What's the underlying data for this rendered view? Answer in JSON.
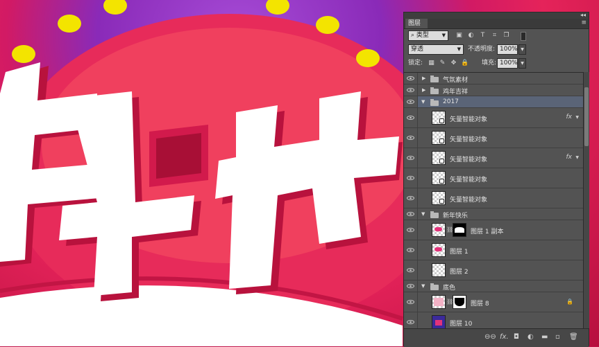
{
  "panel": {
    "title": "图层",
    "collapse_glyph": "◂◂",
    "menu_glyph": "≡"
  },
  "filter": {
    "search_glyph": "⌕",
    "kind_value": "类型"
  },
  "blend": {
    "mode_value": "穿透",
    "opacity_label": "不透明度:",
    "opacity_value": "100%"
  },
  "lock": {
    "label": "锁定:",
    "fill_label": "填充:",
    "fill_value": "100%"
  },
  "layers": [
    {
      "name": "气氛素材",
      "type": "group",
      "expanded": false
    },
    {
      "name": "鸡年吉祥",
      "type": "group",
      "expanded": false
    },
    {
      "name": "2017",
      "type": "group",
      "expanded": true,
      "selected": true
    },
    {
      "name": "矢量智能对象",
      "type": "smart",
      "fx": "fx"
    },
    {
      "name": "矢量智能对象",
      "type": "smart"
    },
    {
      "name": "矢量智能对象",
      "type": "smart",
      "fx": "fx"
    },
    {
      "name": "矢量智能对象",
      "type": "smart"
    },
    {
      "name": "矢量智能对象",
      "type": "smart"
    },
    {
      "name": "新年快乐",
      "type": "group",
      "expanded": true
    },
    {
      "name": "图层 1 副本",
      "type": "masked"
    },
    {
      "name": "图层 1",
      "type": "pixel"
    },
    {
      "name": "图层 2",
      "type": "pixel"
    },
    {
      "name": "底色",
      "type": "group",
      "expanded": true
    },
    {
      "name": "图层 8",
      "type": "masked",
      "locked": true
    },
    {
      "name": "图层 10",
      "type": "pixel"
    }
  ],
  "footer": {
    "link_glyph": "⊖⊖",
    "fx_label": "fx.",
    "mask_glyph": "◘",
    "adjust_glyph": "◐",
    "group_glyph": "▬",
    "new_glyph": "▫",
    "trash_glyph": "🗑"
  },
  "colors": {
    "panel_bg": "#535353",
    "selected_row": "#5a6477",
    "canvas_red": "#e5235a",
    "canvas_purple": "#8a2ab8",
    "dot_yellow": "#f3e400"
  }
}
